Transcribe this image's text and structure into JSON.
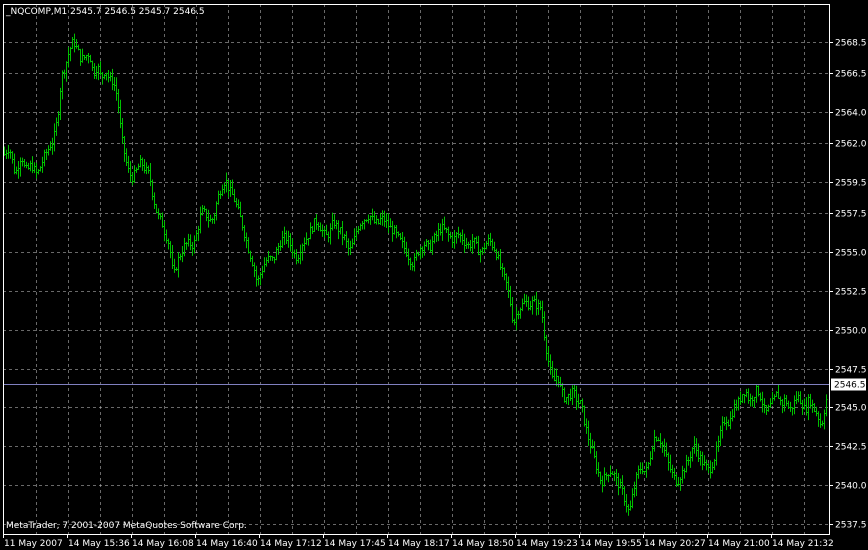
{
  "header": {
    "symbol_label": "_NQCOMP,M1  2545.7 2546.5 2545.7 2546.5"
  },
  "footer": {
    "copyright": "MetaTrader, 7 2001-2007 MetaQuotes Software Corp."
  },
  "colors": {
    "background": "#000000",
    "grid": "#c0c0c0",
    "axis": "#ffffff",
    "bars": "#00c000",
    "price_line": "#8080c0",
    "text": "#ffffff"
  },
  "chart_data": {
    "type": "ohlc",
    "timeframe": "M1",
    "y_ticks": [
      "2568.5",
      "2566.5",
      "2564.0",
      "2562.0",
      "2559.5",
      "2557.5",
      "2555.0",
      "2552.5",
      "2550.0",
      "2547.5",
      "2545.0",
      "2542.5",
      "2540.0",
      "2537.5"
    ],
    "y_tick_values": [
      2568.5,
      2566.5,
      2564.0,
      2562.0,
      2559.5,
      2557.5,
      2555.0,
      2552.5,
      2550.0,
      2547.5,
      2545.0,
      2542.5,
      2540.0,
      2537.5
    ],
    "ylim": [
      2537.0,
      2570.2
    ],
    "x_ticks": [
      "11 May 2007",
      "14 May 15:36",
      "14 May 16:08",
      "14 May 16:40",
      "14 May 17:12",
      "14 May 17:45",
      "14 May 18:17",
      "14 May 18:50",
      "14 May 19:23",
      "14 May 19:55",
      "14 May 20:27",
      "14 May 21:00",
      "14 May 21:32"
    ],
    "current_price": 2546.5,
    "current_price_label": "2546.5",
    "close_path": [
      [
        0,
        2561.2
      ],
      [
        6,
        2561.8
      ],
      [
        12,
        2560.0
      ],
      [
        18,
        2561.3
      ],
      [
        22,
        2560.2
      ],
      [
        28,
        2560.6
      ],
      [
        34,
        2560.0
      ],
      [
        40,
        2561.0
      ],
      [
        46,
        2561.8
      ],
      [
        50,
        2562.2
      ],
      [
        54,
        2563.5
      ],
      [
        58,
        2566.2
      ],
      [
        62,
        2567.0
      ],
      [
        66,
        2568.0
      ],
      [
        70,
        2568.6
      ],
      [
        74,
        2568.0
      ],
      [
        78,
        2567.4
      ],
      [
        82,
        2567.6
      ],
      [
        86,
        2567.8
      ],
      [
        90,
        2566.5
      ],
      [
        94,
        2567.0
      ],
      [
        98,
        2566.2
      ],
      [
        102,
        2566.8
      ],
      [
        106,
        2566.1
      ],
      [
        110,
        2566.0
      ],
      [
        114,
        2565.0
      ],
      [
        118,
        2562.5
      ],
      [
        122,
        2561.0
      ],
      [
        126,
        2560.0
      ],
      [
        130,
        2559.8
      ],
      [
        134,
        2560.4
      ],
      [
        138,
        2560.8
      ],
      [
        142,
        2560.3
      ],
      [
        146,
        2560.0
      ],
      [
        150,
        2558.5
      ],
      [
        154,
        2557.4
      ],
      [
        158,
        2557.0
      ],
      [
        162,
        2556.2
      ],
      [
        166,
        2555.5
      ],
      [
        170,
        2553.4
      ],
      [
        174,
        2554.4
      ],
      [
        178,
        2555.0
      ],
      [
        182,
        2555.5
      ],
      [
        186,
        2555.6
      ],
      [
        190,
        2555.4
      ],
      [
        194,
        2556.4
      ],
      [
        198,
        2557.6
      ],
      [
        202,
        2557.5
      ],
      [
        206,
        2557.0
      ],
      [
        210,
        2557.2
      ],
      [
        214,
        2558.4
      ],
      [
        218,
        2559.2
      ],
      [
        222,
        2559.7
      ],
      [
        226,
        2559.0
      ],
      [
        230,
        2558.6
      ],
      [
        234,
        2557.8
      ],
      [
        238,
        2557.0
      ],
      [
        242,
        2556.0
      ],
      [
        246,
        2555.0
      ],
      [
        250,
        2554.2
      ],
      [
        254,
        2553.0
      ],
      [
        258,
        2553.8
      ],
      [
        262,
        2554.4
      ],
      [
        266,
        2554.6
      ],
      [
        270,
        2554.5
      ],
      [
        274,
        2555.2
      ],
      [
        278,
        2555.8
      ],
      [
        282,
        2556.0
      ],
      [
        286,
        2555.7
      ],
      [
        290,
        2555.0
      ],
      [
        294,
        2554.6
      ],
      [
        298,
        2555.5
      ],
      [
        302,
        2555.8
      ],
      [
        306,
        2556.2
      ],
      [
        310,
        2556.8
      ],
      [
        314,
        2557.0
      ],
      [
        318,
        2556.5
      ],
      [
        322,
        2556.0
      ],
      [
        326,
        2556.2
      ],
      [
        330,
        2557.0
      ],
      [
        334,
        2556.6
      ],
      [
        338,
        2556.2
      ],
      [
        342,
        2555.8
      ],
      [
        346,
        2555.0
      ],
      [
        350,
        2555.6
      ],
      [
        354,
        2556.6
      ],
      [
        358,
        2557.0
      ],
      [
        362,
        2557.2
      ],
      [
        366,
        2557.4
      ],
      [
        370,
        2557.0
      ],
      [
        374,
        2556.8
      ],
      [
        378,
        2557.2
      ],
      [
        382,
        2557.0
      ],
      [
        386,
        2556.6
      ],
      [
        390,
        2556.4
      ],
      [
        394,
        2556.0
      ],
      [
        398,
        2555.6
      ],
      [
        402,
        2555.2
      ],
      [
        406,
        2554.6
      ],
      [
        410,
        2554.2
      ],
      [
        414,
        2555.0
      ],
      [
        418,
        2555.4
      ],
      [
        422,
        2555.6
      ],
      [
        426,
        2555.2
      ],
      [
        430,
        2555.8
      ],
      [
        434,
        2556.2
      ],
      [
        438,
        2556.6
      ],
      [
        442,
        2556.4
      ],
      [
        446,
        2556.0
      ],
      [
        450,
        2555.8
      ],
      [
        454,
        2556.2
      ],
      [
        458,
        2556.0
      ],
      [
        462,
        2555.6
      ],
      [
        466,
        2555.4
      ],
      [
        470,
        2555.8
      ],
      [
        474,
        2555.2
      ],
      [
        478,
        2555.0
      ],
      [
        482,
        2555.5
      ],
      [
        486,
        2555.8
      ],
      [
        490,
        2555.4
      ],
      [
        494,
        2554.8
      ],
      [
        498,
        2553.8
      ],
      [
        502,
        2553.2
      ],
      [
        506,
        2552.2
      ],
      [
        510,
        2550.4
      ],
      [
        514,
        2551.2
      ],
      [
        518,
        2551.6
      ],
      [
        522,
        2551.8
      ],
      [
        526,
        2551.6
      ],
      [
        530,
        2551.8
      ],
      [
        534,
        2551.6
      ],
      [
        538,
        2551.4
      ],
      [
        542,
        2549.2
      ],
      [
        546,
        2547.6
      ],
      [
        550,
        2546.6
      ],
      [
        554,
        2547.2
      ],
      [
        558,
        2546.0
      ],
      [
        562,
        2545.6
      ],
      [
        566,
        2545.8
      ],
      [
        570,
        2546.0
      ],
      [
        574,
        2545.4
      ],
      [
        578,
        2545.2
      ],
      [
        582,
        2543.8
      ],
      [
        586,
        2542.8
      ],
      [
        590,
        2542.0
      ],
      [
        594,
        2541.0
      ],
      [
        598,
        2540.2
      ],
      [
        602,
        2540.6
      ],
      [
        606,
        2541.0
      ],
      [
        610,
        2540.8
      ],
      [
        614,
        2540.2
      ],
      [
        618,
        2539.8
      ],
      [
        622,
        2539.0
      ],
      [
        626,
        2538.2
      ],
      [
        630,
        2539.6
      ],
      [
        634,
        2540.8
      ],
      [
        638,
        2541.2
      ],
      [
        642,
        2540.8
      ],
      [
        646,
        2541.6
      ],
      [
        650,
        2543.0
      ],
      [
        654,
        2543.2
      ],
      [
        658,
        2542.8
      ],
      [
        662,
        2542.0
      ],
      [
        666,
        2541.2
      ],
      [
        670,
        2540.6
      ],
      [
        674,
        2540.2
      ],
      [
        678,
        2540.8
      ],
      [
        682,
        2541.2
      ],
      [
        686,
        2541.8
      ],
      [
        690,
        2542.6
      ],
      [
        694,
        2542.2
      ],
      [
        698,
        2541.6
      ],
      [
        702,
        2541.2
      ],
      [
        706,
        2541.0
      ],
      [
        710,
        2541.6
      ],
      [
        714,
        2542.4
      ],
      [
        718,
        2543.6
      ],
      [
        722,
        2544.4
      ],
      [
        726,
        2544.0
      ],
      [
        730,
        2545.0
      ],
      [
        734,
        2545.2
      ],
      [
        738,
        2545.8
      ],
      [
        742,
        2546.2
      ],
      [
        746,
        2545.4
      ],
      [
        750,
        2545.8
      ],
      [
        754,
        2546.2
      ],
      [
        758,
        2545.6
      ],
      [
        762,
        2544.6
      ],
      [
        766,
        2545.0
      ],
      [
        770,
        2545.4
      ],
      [
        774,
        2546.0
      ],
      [
        778,
        2545.2
      ],
      [
        782,
        2545.6
      ],
      [
        786,
        2544.8
      ],
      [
        790,
        2545.2
      ],
      [
        794,
        2545.8
      ],
      [
        798,
        2545.4
      ],
      [
        802,
        2544.8
      ],
      [
        806,
        2545.6
      ],
      [
        810,
        2545.0
      ],
      [
        814,
        2544.6
      ],
      [
        818,
        2543.8
      ],
      [
        822,
        2545.2
      ],
      [
        826,
        2546.5
      ]
    ],
    "grid": true,
    "legend": "none"
  }
}
